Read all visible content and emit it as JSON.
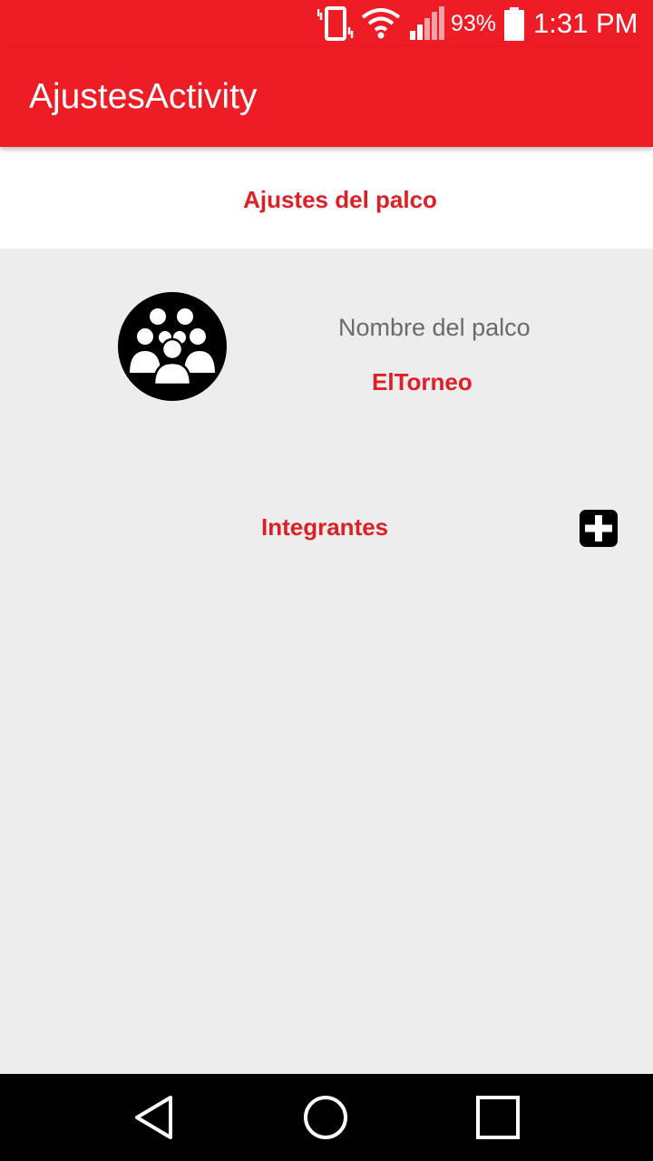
{
  "status_bar": {
    "battery_percent": "93%",
    "time": "1:31 PM",
    "icons": [
      "vibrate-icon",
      "wifi-icon",
      "signal-icon",
      "battery-icon"
    ]
  },
  "app_bar": {
    "title": "AjustesActivity"
  },
  "header": {
    "title": "Ajustes del palco"
  },
  "palco": {
    "avatar_icon": "group-icon",
    "name_label": "Nombre del palco",
    "name_value": "ElTorneo"
  },
  "members": {
    "label": "Integrantes",
    "add_icon": "plus-icon"
  },
  "nav_bar": {
    "icons": [
      "back-icon",
      "home-icon",
      "recents-icon"
    ]
  },
  "colors": {
    "primary": "#ee1c25",
    "accent_text": "#de1f26",
    "background": "#ededed"
  }
}
